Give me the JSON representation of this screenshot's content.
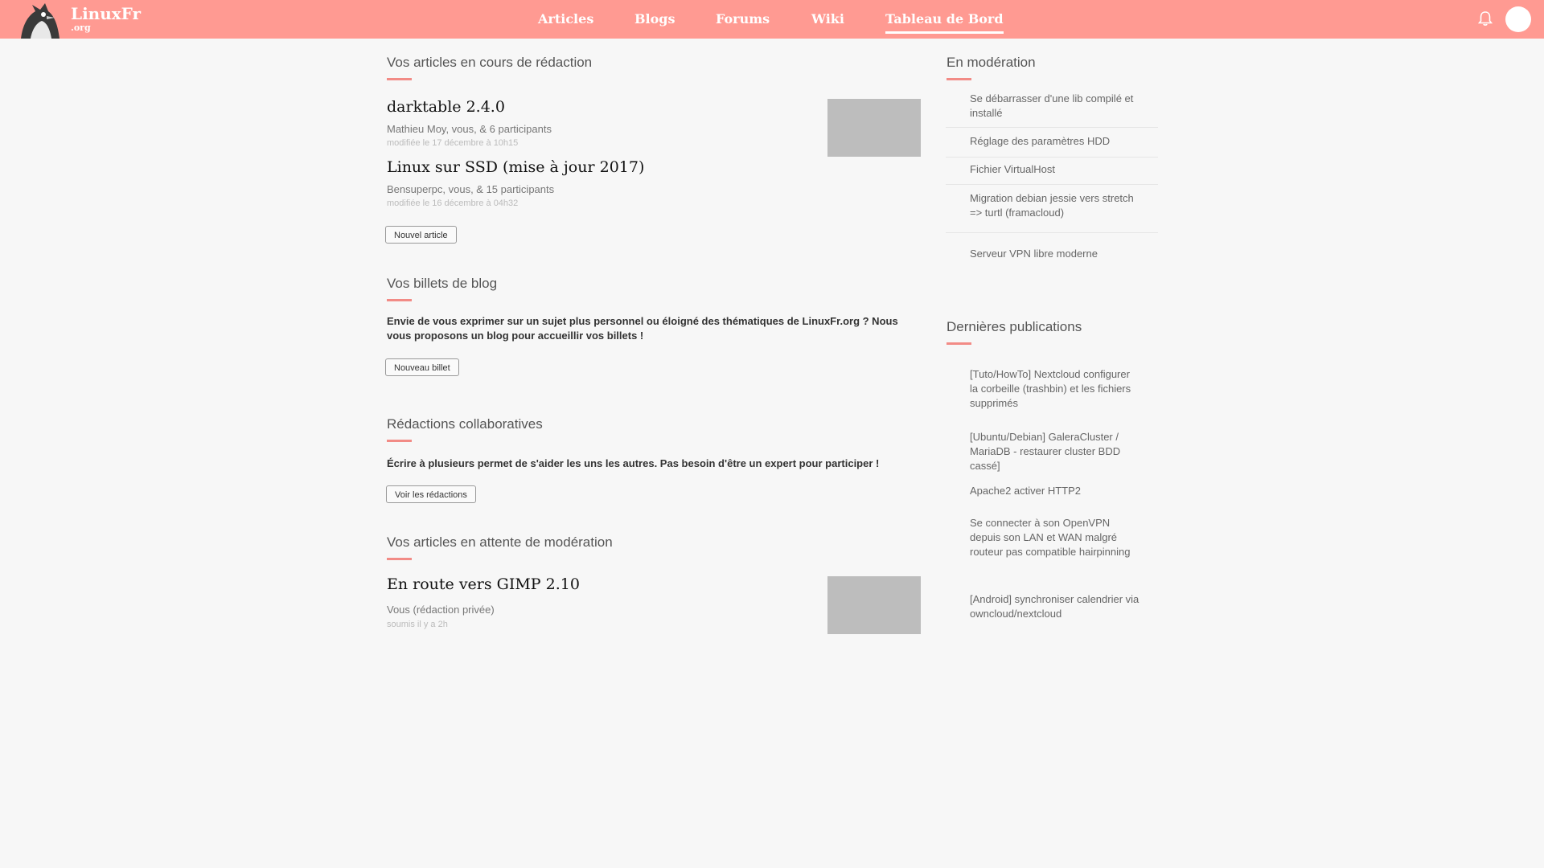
{
  "site": {
    "name": "LinuxFr",
    "tld": ".org"
  },
  "nav": [
    {
      "label": "Articles"
    },
    {
      "label": "Blogs"
    },
    {
      "label": "Forums"
    },
    {
      "label": "Wiki"
    },
    {
      "label": "Tableau de Bord",
      "active": true
    }
  ],
  "drafts": {
    "title": "Vos articles en cours de rédaction",
    "items": [
      {
        "title": "darktable 2.4.0",
        "authors": "Mathieu Moy, vous, & 6 participants",
        "date": "modifiée le 17 décembre à 10h15"
      },
      {
        "title": "Linux sur SSD (mise à jour 2017)",
        "authors": "Bensuperpc, vous, & 15 participants",
        "date": "modifiée le 16 décembre à 04h32"
      }
    ],
    "button": "Nouvel article"
  },
  "blog": {
    "title": "Vos billets de blog",
    "text": "Envie de vous exprimer sur un sujet plus personnel ou éloigné des thématiques de LinuxFr.org ? Nous vous proposons un blog pour accueillir vos billets !",
    "button": "Nouveau billet"
  },
  "collab": {
    "title": "Rédactions collaboratives",
    "text": "Écrire à plusieurs permet de s'aider les uns les autres. Pas besoin d'être un expert pour participer !",
    "button": "Voir les rédactions"
  },
  "pending": {
    "title": "Vos articles en attente de modération",
    "items": [
      {
        "title": "En route vers GIMP 2.10",
        "authors": "Vous (rédaction privée)",
        "date": "soumis il y a 2h"
      }
    ]
  },
  "moderation": {
    "title": "En modération",
    "items": [
      "Se débarrasser d'une lib compilé et installé",
      "Réglage des paramètres HDD",
      "Fichier VirtualHost",
      "Migration debian jessie vers stretch => turtl (framacloud)",
      "Serveur VPN libre moderne"
    ]
  },
  "latest": {
    "title": "Dernières publications",
    "items": [
      "[Tuto/HowTo] Nextcloud configurer la corbeille (trashbin) et les fichiers supprimés",
      "[Ubuntu/Debian] GaleraCluster / MariaDB - restaurer cluster BDD cassé]",
      "Apache2 activer HTTP2",
      "Se connecter à son OpenVPN depuis son LAN et WAN malgré routeur pas compatible hairpinning",
      "[Android] synchroniser calendrier via owncloud/nextcloud"
    ]
  },
  "colors": {
    "header": "#ff9a92",
    "accent": "#f28b86",
    "thumb": "#bdbdbd"
  },
  "icons": {
    "logo": "penguin-logo-icon",
    "bell": "bell-icon"
  }
}
